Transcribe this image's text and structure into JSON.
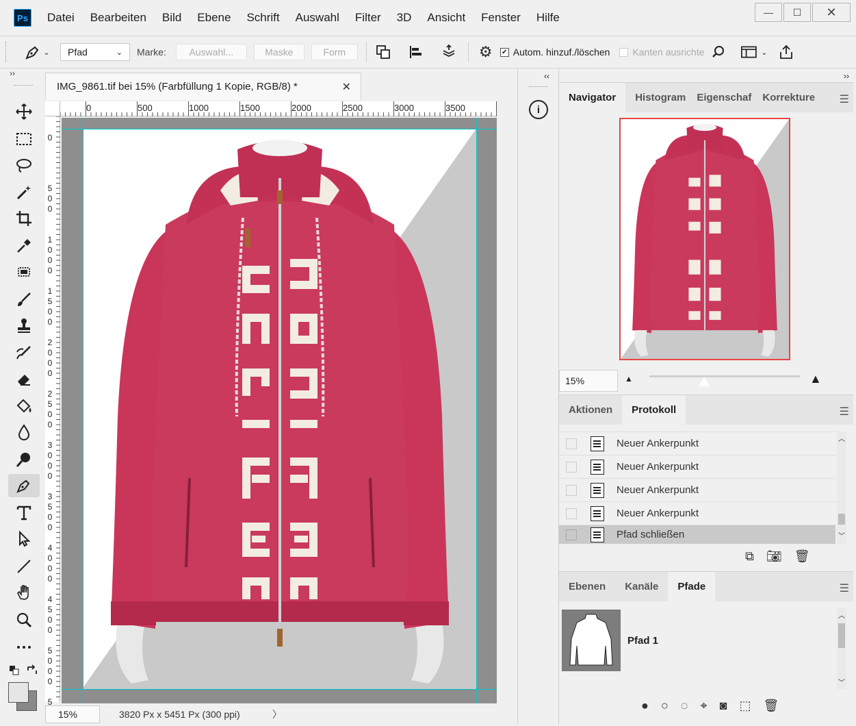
{
  "app": {
    "logo_text": "Ps"
  },
  "menu": [
    "Datei",
    "Bearbeiten",
    "Bild",
    "Ebene",
    "Schrift",
    "Auswahl",
    "Filter",
    "3D",
    "Ansicht",
    "Fenster",
    "Hilfe"
  ],
  "window_controls": {
    "minimize": "—",
    "maximize": "☐",
    "close": "✕"
  },
  "options": {
    "mode_value": "Pfad",
    "marke_label": "Marke:",
    "btn_auswahl": "Auswahl...",
    "btn_maske": "Maske",
    "btn_form": "Form",
    "auto_add_label": "Autom. hinzuf./löschen",
    "kanten_label": "Kanten ausrichte"
  },
  "collapse_left": "››",
  "document": {
    "tab_title": "IMG_9861.tif bei 15% (Farbfüllung 1 Kopie, RGB/8) *",
    "close": "✕",
    "ruler_h": [
      "0",
      "500",
      "1000",
      "1500",
      "2000",
      "2500",
      "3000",
      "3500"
    ],
    "ruler_v": [
      "0",
      "500",
      "1000",
      "1500",
      "2000",
      "2500",
      "3000",
      "3500",
      "4000",
      "4500",
      "5000",
      "5"
    ],
    "status_zoom": "15%",
    "status_info": "3820 Px x 5451 Px (300 ppi)",
    "status_arrow": "〉"
  },
  "navigator_panel": {
    "tabs": [
      "Navigator",
      "Histogram",
      "Eigenschaf",
      "Korrekture"
    ],
    "zoom": "15%"
  },
  "history_panel": {
    "tabs": [
      "Aktionen",
      "Protokoll"
    ],
    "items": [
      "Neuer Ankerpunkt",
      "Neuer Ankerpunkt",
      "Neuer Ankerpunkt",
      "Neuer Ankerpunkt",
      "Pfad schließen"
    ]
  },
  "paths_panel": {
    "tabs": [
      "Ebenen",
      "Kanäle",
      "Pfade"
    ],
    "path_name": "Pfad 1"
  },
  "colors": {
    "jacket": "#c9365a",
    "jacket_dark": "#a8284a",
    "lining": "#f3ece2",
    "nav_border": "#e84545",
    "guide": "#00c8d0"
  }
}
